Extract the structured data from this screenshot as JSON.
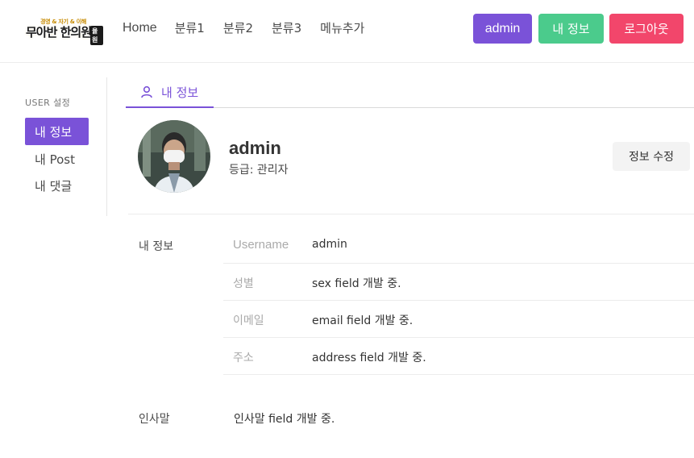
{
  "header": {
    "logo": {
      "top_text": "경영 & 자기 & 이해",
      "main_text": "무아반 한의원",
      "badge": "율원"
    },
    "nav": [
      "Home",
      "분류1",
      "분류2",
      "분류3",
      "메뉴추가"
    ],
    "buttons": {
      "admin": "admin",
      "my_info": "내 정보",
      "logout": "로그아웃"
    },
    "colors": {
      "admin": "#7a52d8",
      "my_info": "#4bcb8c",
      "logout": "#f2466b"
    }
  },
  "sidebar": {
    "title": "USER 설정",
    "items": [
      {
        "label": "내 정보",
        "active": true
      },
      {
        "label": "내 Post",
        "active": false
      },
      {
        "label": "내 댓글",
        "active": false
      }
    ]
  },
  "tabs": [
    {
      "label": "내 정보",
      "icon": "user-icon",
      "active": true
    }
  ],
  "profile": {
    "name": "admin",
    "grade": "등급: 관리자",
    "edit_button": "정보 수정"
  },
  "info": {
    "section_label": "내 정보",
    "rows": [
      {
        "key": "Username",
        "value": "admin"
      },
      {
        "key": "성별",
        "value": "sex field 개발 중."
      },
      {
        "key": "이메일",
        "value": "email field 개발 중."
      },
      {
        "key": "주소",
        "value": "address field 개발 중."
      }
    ]
  },
  "greeting": {
    "label": "인사말",
    "value": "인사말 field 개발 중."
  }
}
